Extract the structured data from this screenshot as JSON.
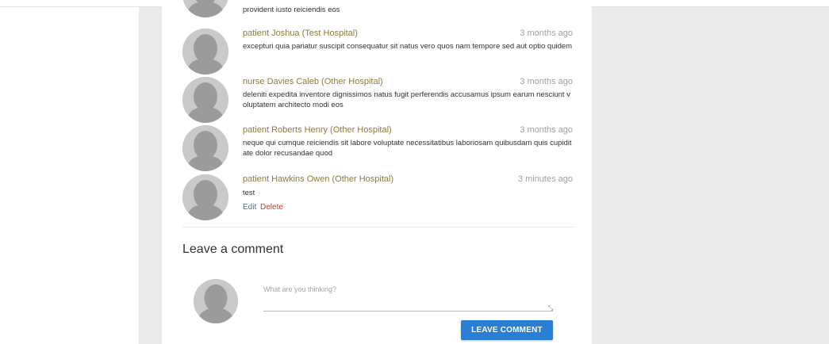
{
  "comments": [
    {
      "author": "",
      "time": "",
      "text": "provident iusto reiciendis eos"
    },
    {
      "author": "patient Joshua (Test Hospital)",
      "time": "3 months ago",
      "text": "excepturi quia pariatur suscipit consequatur sit natus vero quos nam tempore sed aut optio quidem"
    },
    {
      "author": "nurse Davies Caleb (Other Hospital)",
      "time": "3 months ago",
      "text": "deleniti expedita inventore dignissimos natus fugit perferendis accusamus ipsum earum nesciunt voluptatem architecto modi eos"
    },
    {
      "author": "patient Roberts Henry (Other Hospital)",
      "time": "3 months ago",
      "text": "neque qui cumque reiciendis sit labore voluptate necessitatibus laboriosam quibusdam quis cupiditate dolor recusandae quod"
    },
    {
      "author": "patient Hawkins Owen (Other Hospital)",
      "time": "3 minutes ago",
      "text": "test",
      "edit_label": "Edit",
      "delete_label": "Delete"
    }
  ],
  "leave_comment": {
    "title": "Leave a comment",
    "placeholder": "What are you thinking?",
    "value": "",
    "button_label": "LEAVE COMMENT"
  },
  "icons": {
    "avatar": "user-silhouette-icon",
    "resize": "resize-handle-icon"
  },
  "colors": {
    "author": "#8f7a3c",
    "timestamp": "#a0a0a0",
    "button": "#2a7fd4",
    "edit_link": "#3d6fa8",
    "delete_link": "#c0392b",
    "avatar": "#c9c9c9"
  }
}
